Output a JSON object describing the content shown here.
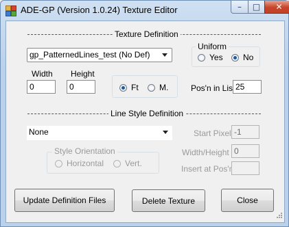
{
  "window": {
    "title": "ADE-GP (Version 1.0.24) Texture Editor",
    "minimize_glyph": "–",
    "maximize_glyph": "□",
    "close_glyph": "✕"
  },
  "texture_definition": {
    "header": "Texture Definition",
    "texture_select": "gp_PatternedLines_test (No Def)",
    "width_label": "Width",
    "width_value": "0",
    "height_label": "Height",
    "height_value": "0",
    "units": {
      "ft_label": "Ft",
      "m_label": "M.",
      "selected": "Ft"
    },
    "uniform": {
      "label": "Uniform",
      "yes_label": "Yes",
      "no_label": "No",
      "selected": "No"
    },
    "position_label": "Pos'n in List",
    "position_value": "25"
  },
  "line_style_definition": {
    "header": "Line Style Definition",
    "line_style_select": "None",
    "orientation": {
      "label": "Style Orientation",
      "horizontal_label": "Horizontal",
      "vertical_label": "Vert."
    },
    "start_pixel_label": "Start Pixel",
    "start_pixel_value": "-1",
    "width_height_label": "Width/Height",
    "width_height_value": "0",
    "insert_label": "Insert at Pos'n",
    "insert_value": ""
  },
  "buttons": {
    "update": "Update Definition Files",
    "delete": "Delete Texture",
    "close": "Close"
  }
}
